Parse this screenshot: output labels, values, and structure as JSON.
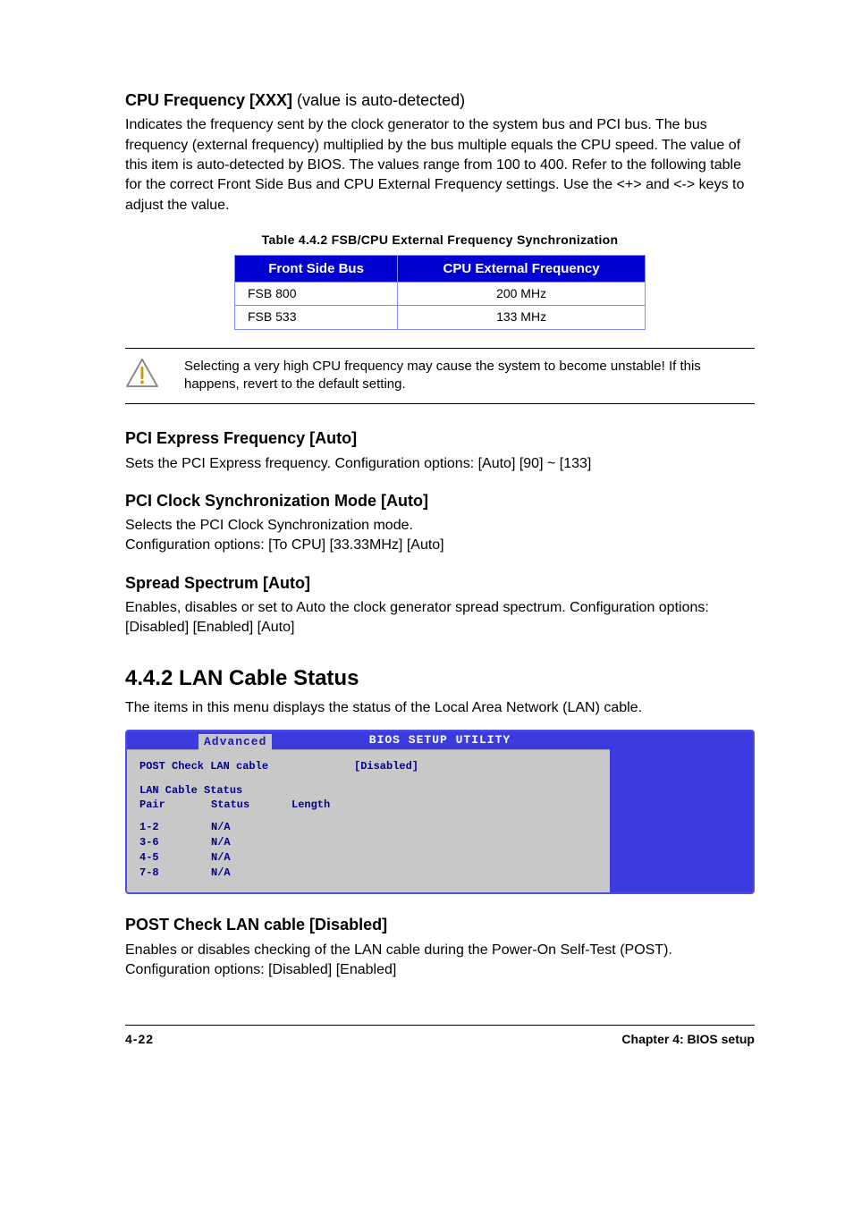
{
  "section1": {
    "heading_prefix": "CPU Frequency [XXX] ",
    "heading_suffix": "(value is auto-detected)",
    "body": "Indicates the frequency sent by the clock generator to the system bus and PCI bus. The bus frequency (external frequency) multiplied by the bus multiple equals the CPU speed. The value of this item is auto-detected by BIOS. The values range from 100 to 400. Refer to the following table for the correct Front Side Bus and CPU External Frequency settings. Use the <+> and <-> keys to adjust the value."
  },
  "table": {
    "caption": "Table 4.4.2 FSB/CPU External Frequency Synchronization",
    "head": [
      "Front Side Bus",
      "CPU External Frequency"
    ],
    "rows": [
      [
        "FSB 800",
        "200 MHz"
      ],
      [
        "FSB 533",
        "133 MHz"
      ]
    ]
  },
  "warning": "Selecting a very high CPU frequency may cause the system to become unstable! If this happens, revert to the default setting.",
  "sections": [
    {
      "heading": "PCI Express Frequency [Auto]",
      "body": "Sets the PCI Express frequency. Configuration options: [Auto] [90] ~ [133]"
    },
    {
      "heading": "PCI Clock Synchronization Mode [Auto]",
      "body": "Selects the PCI Clock Synchronization mode.\nConfiguration options: [To CPU] [33.33MHz] [Auto]"
    },
    {
      "heading": "Spread Spectrum [Auto]",
      "body": "Enables, disables or set to Auto the clock generator spread spectrum. Configuration options: [Disabled] [Enabled] [Auto]"
    }
  ],
  "major_heading": "4.4.2   LAN Cable Status",
  "major_body": "The items in this menu displays the status of the Local Area Network (LAN) cable.",
  "bios": {
    "title": "BIOS SETUP UTILITY",
    "tab": "Advanced",
    "item_label": "POST Check LAN cable",
    "item_value": "[Disabled]",
    "sub_heading": "LAN Cable Status",
    "cols": [
      "Pair",
      "Status",
      "Length"
    ],
    "rows": [
      [
        "1-2",
        "N/A",
        ""
      ],
      [
        "3-6",
        "N/A",
        ""
      ],
      [
        "4-5",
        "N/A",
        ""
      ],
      [
        "7-8",
        "N/A",
        ""
      ]
    ]
  },
  "post_section": {
    "heading": "POST Check LAN cable [Disabled]",
    "body": "Enables or disables checking of the LAN cable during the Power-On Self-Test (POST). Configuration options: [Disabled] [Enabled]"
  },
  "footer": {
    "left": "4-22",
    "right": "Chapter 4: BIOS setup"
  }
}
